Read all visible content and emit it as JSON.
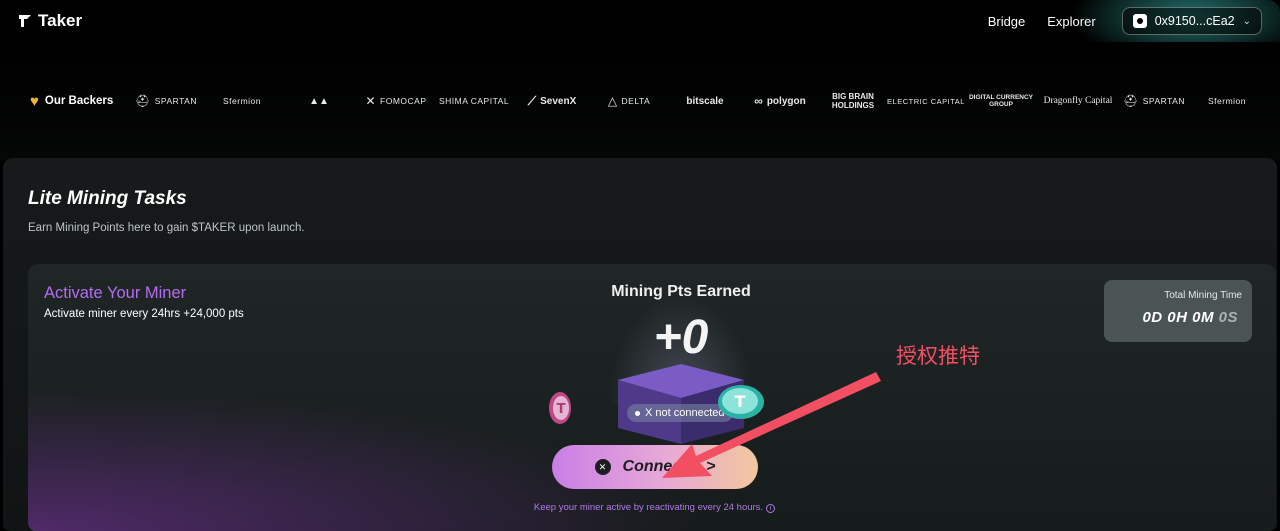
{
  "header": {
    "logo_text": "Taker",
    "nav": [
      "Bridge",
      "Explorer"
    ],
    "wallet_address": "0x9150...cEa2"
  },
  "backers": {
    "title": "Our Backers",
    "logos": [
      {
        "text": "SPARTAN",
        "icon": "helmet-icon"
      },
      {
        "text": "Sfermion"
      },
      {
        "text": "▲▲",
        "icon": "mountain-icon"
      },
      {
        "text": "FOMOCAP",
        "icon": "x-mark-icon"
      },
      {
        "text": "SHIMA CAPITAL"
      },
      {
        "text": "SevenX"
      },
      {
        "text": "DELTA",
        "icon": "delta-icon"
      },
      {
        "text": "bitscale"
      },
      {
        "text": "polygon",
        "icon": "infinity-icon"
      },
      {
        "text": "BIG BRAIN HOLDINGS"
      },
      {
        "text": "ELECTRIC CAPITAL"
      },
      {
        "text": "DIGITAL CURRENCY GROUP"
      },
      {
        "text": "Dragonfly Capital"
      },
      {
        "text": "SPARTAN",
        "icon": "helmet-icon"
      },
      {
        "text": "Sfermion"
      }
    ]
  },
  "panel": {
    "title": "Lite Mining Tasks",
    "subtitle": "Earn Mining Points here to gain $TAKER upon launch."
  },
  "miner": {
    "title": "Activate Your Miner",
    "subtitle": "Activate miner every 24hrs +24,000 pts",
    "pts_label": "Mining Pts Earned",
    "pts_value": "+0",
    "status": "X not connected",
    "connect_label": "Connect X >",
    "keep_note": "Keep your miner active by reactivating every 24 hours.",
    "time_label": "Total Mining Time",
    "time_main": "0D 0H 0M",
    "time_seconds": "0S"
  },
  "annotation": {
    "text": "授权推特"
  },
  "colors": {
    "accent_purple": "#b56cf4",
    "annotation_red": "#f24f63",
    "button_gradient_start": "#c97ee6",
    "button_gradient_end": "#f1c79d"
  }
}
